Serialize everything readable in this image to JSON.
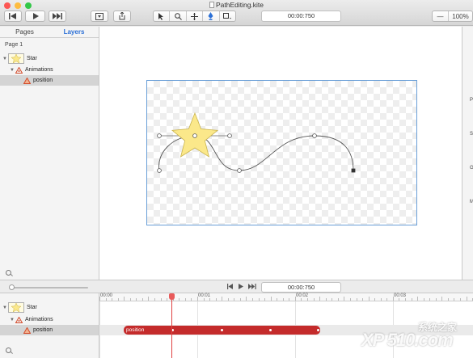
{
  "window": {
    "title": "PathEditing.kite",
    "controls": [
      "close",
      "minimize",
      "zoom"
    ],
    "colors": {
      "close": "#fc5753",
      "minimize": "#fdbc40",
      "zoom": "#33c748"
    }
  },
  "toolbar": {
    "transport_icons": [
      "skip-back-icon",
      "play-icon",
      "skip-forward-icon"
    ],
    "time": "00:00:750",
    "zoom_minus": "—",
    "zoom": "100%",
    "tools": [
      "pointer-icon",
      "zoom-tool-icon",
      "move-tool-icon",
      "pen-tool-icon",
      "shape-tool-icon"
    ]
  },
  "sidebar": {
    "tabs": [
      {
        "label": "Pages"
      },
      {
        "label": "Layers",
        "active": true
      }
    ],
    "page_label": "Page 1",
    "layers": [
      {
        "label": "Star",
        "type": "layer",
        "expanded": true
      },
      {
        "label": "Animations",
        "type": "group",
        "expanded": true
      },
      {
        "label": "position",
        "type": "animation",
        "selected": true
      }
    ]
  },
  "inspector": {
    "labels": [
      "P",
      "S",
      "G",
      "M"
    ]
  },
  "transport": {
    "time": "00:00:750"
  },
  "timeline": {
    "ruler_labels": [
      "00:00",
      "00:01",
      "00:02",
      "00:03"
    ],
    "tracks": [
      {
        "label": "Star"
      },
      {
        "label": "Animations"
      },
      {
        "label": "position"
      }
    ],
    "animation_bar": {
      "label": "position",
      "color": "#c42b2b"
    },
    "playhead_color": "#e04040"
  },
  "canvas": {
    "star_color": "#fbe88a",
    "artboard_border_color": "#6a9fd8"
  },
  "watermark": {
    "text_top": "系统之家",
    "text_bottom": "XP 510.com"
  }
}
